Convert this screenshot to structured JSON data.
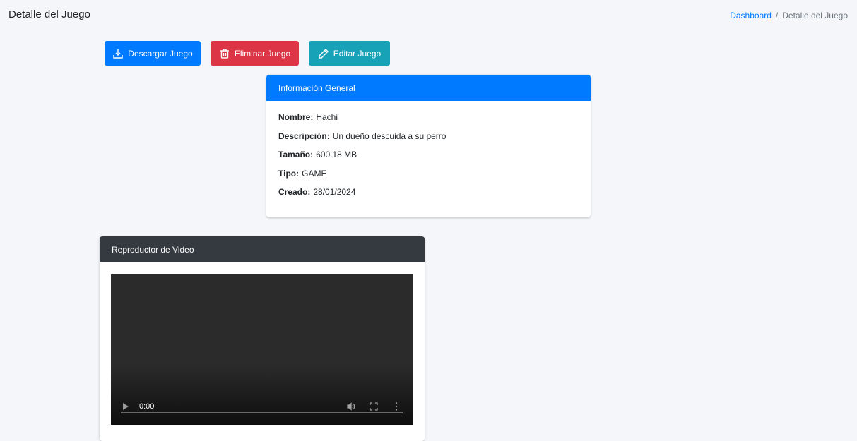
{
  "header": {
    "title": "Detalle del Juego",
    "breadcrumb": {
      "link": "Dashboard",
      "separator": "/",
      "current": "Detalle del Juego"
    }
  },
  "actions": {
    "download_label": "Descargar Juego",
    "delete_label": "Eliminar Juego",
    "edit_label": "Editar Juego"
  },
  "info_card": {
    "title": "Información General",
    "fields": [
      {
        "label": "Nombre:",
        "value": "Hachi"
      },
      {
        "label": "Descripción:",
        "value": "Un dueño descuida a su perro"
      },
      {
        "label": "Tamaño:",
        "value": "600.18 MB"
      },
      {
        "label": "Tipo:",
        "value": "GAME"
      },
      {
        "label": "Creado:",
        "value": "28/01/2024"
      }
    ]
  },
  "video_card": {
    "title": "Reproductor de Video",
    "time": "0:00",
    "icons": [
      "play-icon",
      "volume-icon",
      "fullscreen-icon",
      "more-options-icon"
    ]
  },
  "colors": {
    "primary": "#007bff",
    "danger": "#dc3545",
    "info": "#17a2b8",
    "dark": "#343a40",
    "background": "#f4f6f9"
  }
}
